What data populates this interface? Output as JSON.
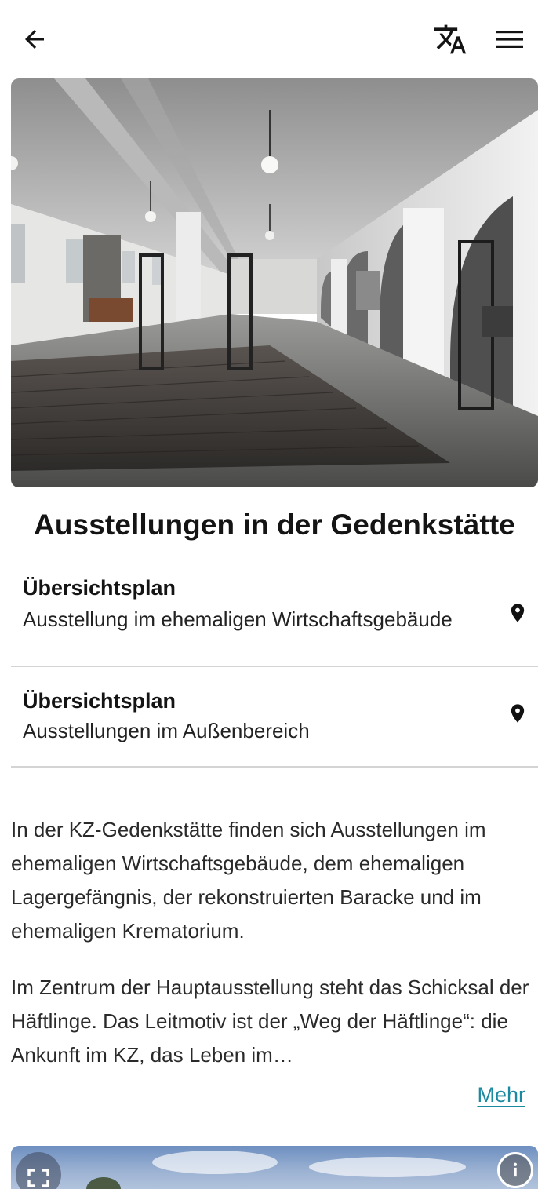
{
  "header": {
    "back_icon": "arrow-left-icon",
    "translate_icon": "translate-icon",
    "menu_icon": "hamburger-menu-icon"
  },
  "hero_image": {
    "subject": "exhibition-hall-photo"
  },
  "page_title": "Ausstellungen in der Gedenkstätte",
  "plans": [
    {
      "title": "Übersichtsplan",
      "description": "Ausstellung im ehemaligen Wirtschaftsgebäude",
      "icon": "map-pin-icon"
    },
    {
      "title": "Übersichtsplan",
      "description": "Ausstellungen im Außenbereich",
      "icon": "map-pin-icon"
    }
  ],
  "body": {
    "paragraph_1": "In der KZ-Gedenkstätte finden sich Ausstellungen im ehemaligen Wirtschaftsgebäude, dem ehemaligen Lagergefängnis, der rekonstruierten Baracke und im ehemaligen Krematorium.",
    "paragraph_2": "Im Zentrum der Hauptausstellung steht das Schicksal der Häftlinge. Das Leitmotiv ist der „Weg der Häftlinge“: die Ankunft im KZ, das Leben im…",
    "more_label": "Mehr"
  },
  "gallery": {
    "fullscreen_icon": "fullscreen-icon",
    "info_icon": "info-icon"
  },
  "colors": {
    "accent": "#1a8aa0",
    "divider": "#d4d4d4",
    "text": "#141414"
  }
}
